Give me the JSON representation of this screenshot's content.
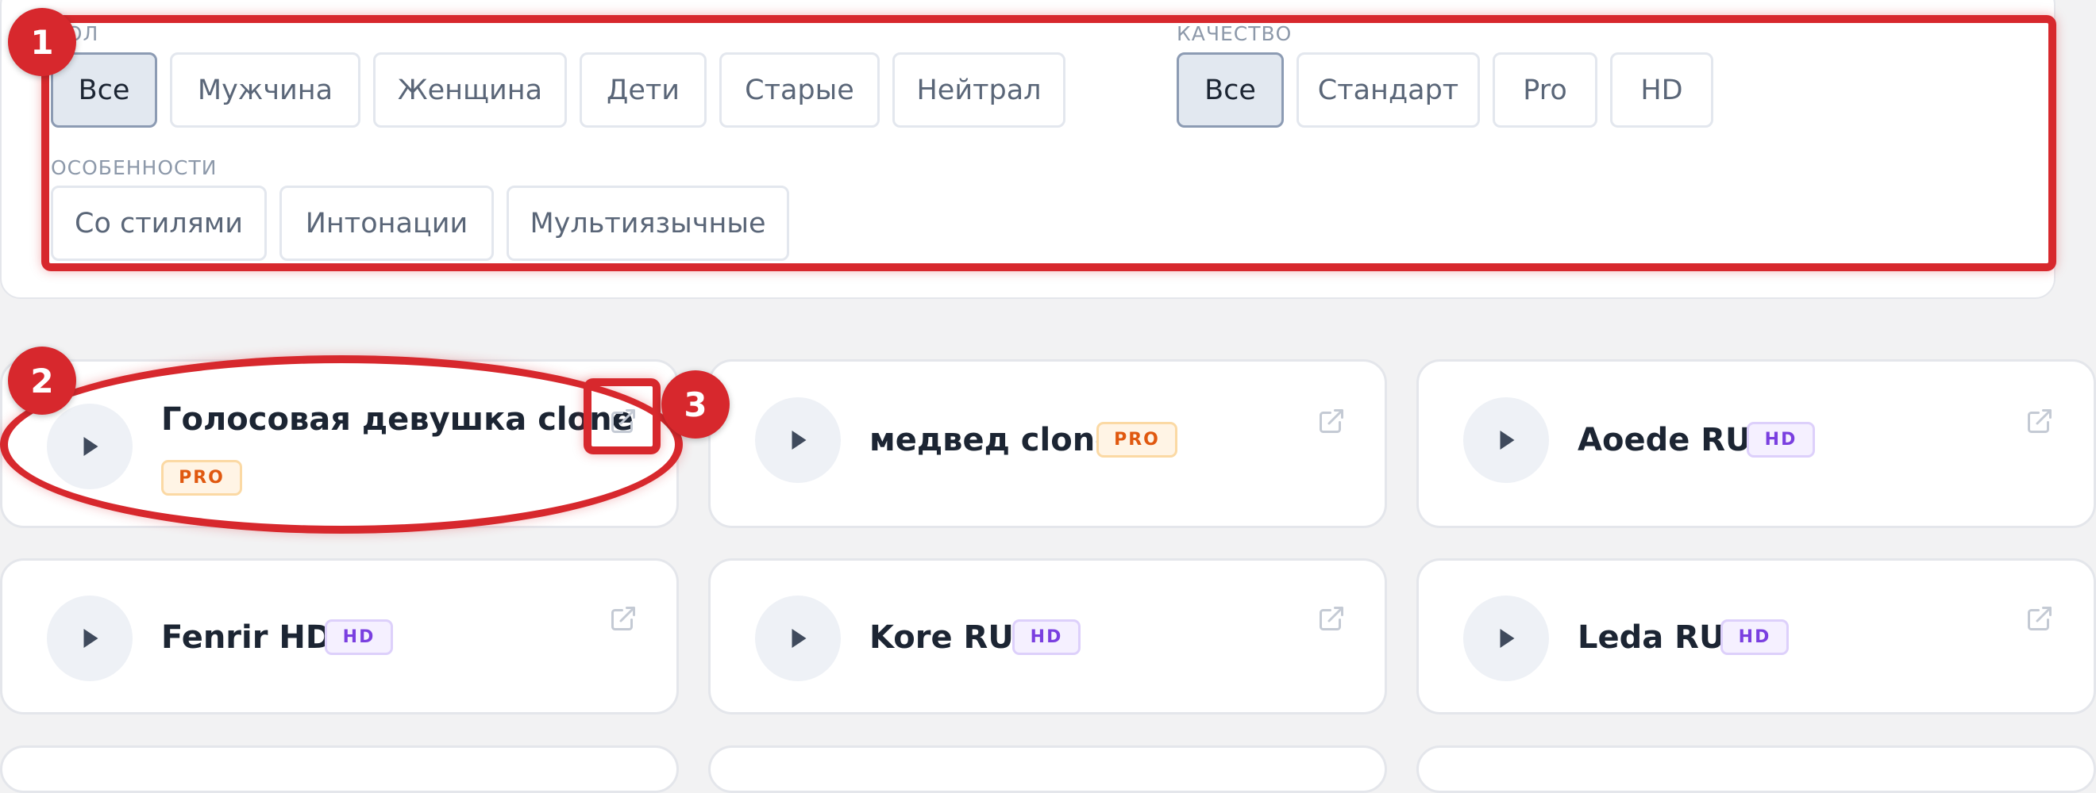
{
  "filters": {
    "gender": {
      "label": "ПОЛ",
      "options": [
        "Все",
        "Мужчина",
        "Женщина",
        "Дети",
        "Старые",
        "Нейтрал"
      ],
      "selected": "Все"
    },
    "quality": {
      "label": "КАЧЕСТВО",
      "options": [
        "Все",
        "Стандарт",
        "Pro",
        "HD"
      ],
      "selected": "Все"
    },
    "features": {
      "label": "ОСОБЕННОСТИ",
      "options": [
        "Со стилями",
        "Интонации",
        "Мультиязычные"
      ]
    }
  },
  "voices": [
    {
      "name": "Голосовая девушка clone",
      "badge": "PRO",
      "badge_type": "pro"
    },
    {
      "name": "медвед clone",
      "badge": "PRO",
      "badge_type": "pro"
    },
    {
      "name": "Aoede RU",
      "badge": "HD",
      "badge_type": "hd"
    },
    {
      "name": "Fenrir HD",
      "badge": "HD",
      "badge_type": "hd"
    },
    {
      "name": "Kore RU",
      "badge": "HD",
      "badge_type": "hd"
    },
    {
      "name": "Leda RU",
      "badge": "HD",
      "badge_type": "hd"
    }
  ],
  "icons": {
    "play": "play-icon",
    "open": "external-link-icon"
  },
  "annotations": [
    "1",
    "2",
    "3"
  ],
  "colors": {
    "annotation": "#d7282d",
    "pro_badge": "#e0580f",
    "hd_badge": "#7a3fe0",
    "chip_active_bg": "#e2e8f0"
  }
}
